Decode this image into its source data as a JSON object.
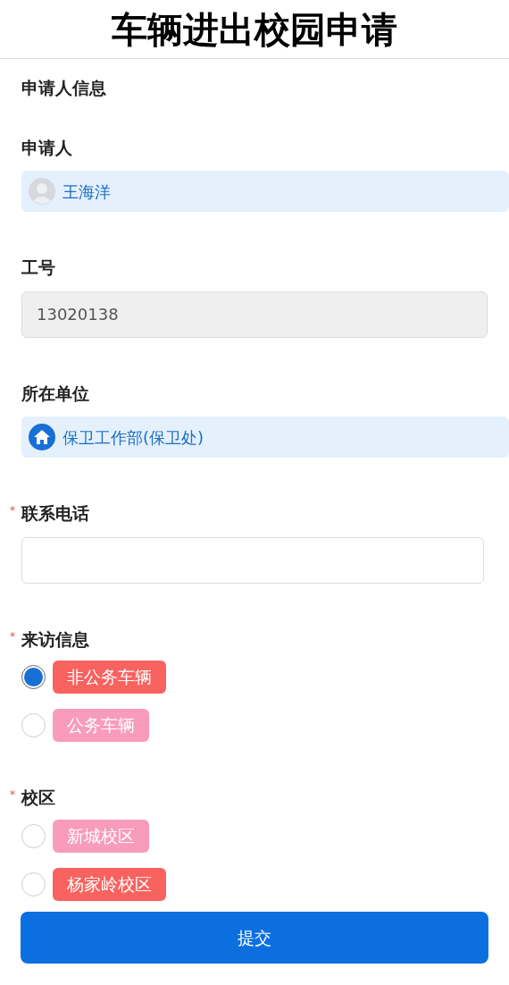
{
  "title": "车辆进出校园申请",
  "section": "申请人信息",
  "fields": [
    {
      "kind": "person",
      "label": "申请人",
      "value": "王海洋"
    },
    {
      "kind": "readonly",
      "label": "工号",
      "value": "13020138"
    },
    {
      "kind": "unit",
      "label": "所在单位",
      "value": "保卫工作部(保卫处)"
    },
    {
      "kind": "input",
      "label": "联系电话",
      "required_mark": "*"
    },
    {
      "kind": "radio",
      "label": "来访信息",
      "required_mark": "*",
      "options": [
        {
          "label": "非公务车辆",
          "selected": true,
          "color": "#f8625f"
        },
        {
          "label": "公务车辆",
          "selected": false,
          "color": "#f99bbb"
        }
      ]
    },
    {
      "kind": "radio",
      "label": "校区",
      "required_mark": "*",
      "options": [
        {
          "label": "新城校区",
          "selected": false,
          "color": "#f99bbb"
        },
        {
          "label": "杨家岭校区",
          "selected": false,
          "color": "#f8625f"
        }
      ]
    }
  ],
  "submit": "提交"
}
